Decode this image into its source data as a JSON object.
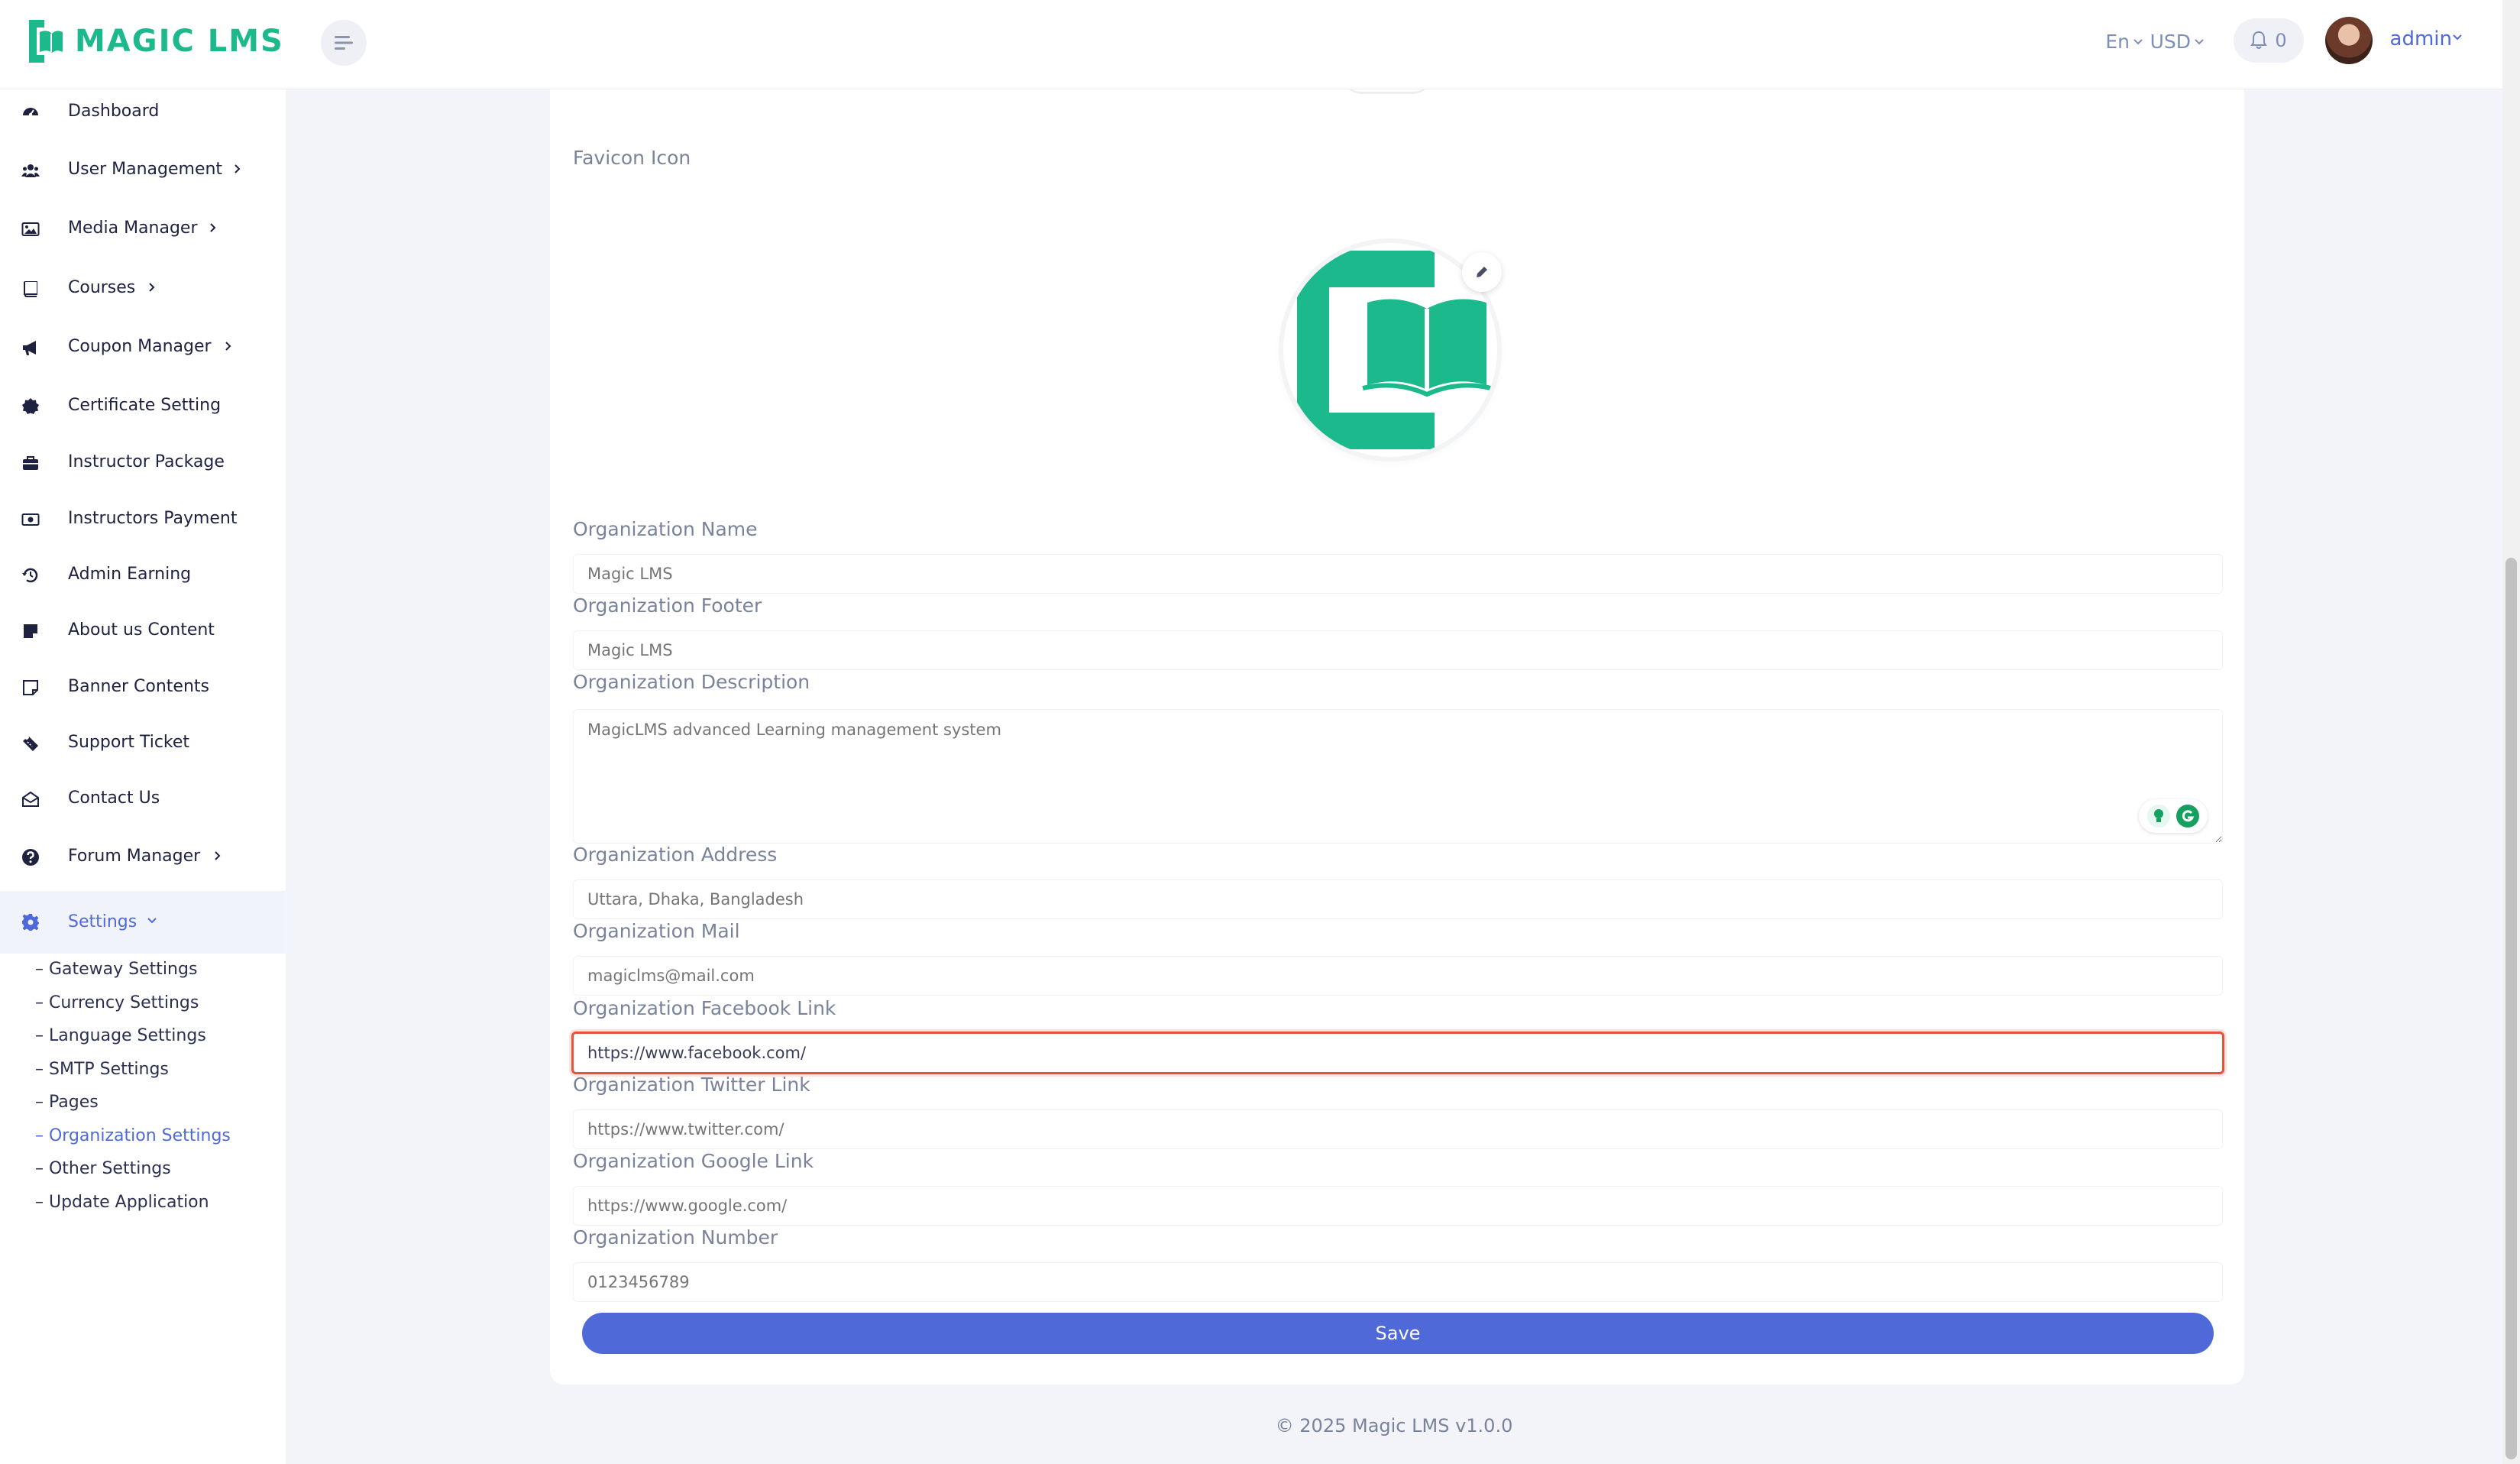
{
  "app": {
    "logo_text": "MAGIC LMS",
    "accent": "#4f6ad8",
    "brand": "#1cb98d"
  },
  "topbar": {
    "language": "En",
    "currency": "USD",
    "notification_count": "0",
    "user_name": "admin"
  },
  "sidebar": {
    "items": [
      {
        "label": "Dashboard",
        "icon": "dashboard-icon"
      },
      {
        "label": "User Management",
        "icon": "users-icon"
      },
      {
        "label": "Media Manager",
        "icon": "image-icon"
      },
      {
        "label": "Courses",
        "icon": "book-icon"
      },
      {
        "label": "Coupon Manager",
        "icon": "megaphone-icon"
      },
      {
        "label": "Certificate Setting",
        "icon": "certificate-icon"
      },
      {
        "label": "Instructor Package",
        "icon": "briefcase-icon"
      },
      {
        "label": "Instructors Payment",
        "icon": "money-icon"
      },
      {
        "label": "Admin Earning",
        "icon": "history-icon"
      },
      {
        "label": "About us Content",
        "icon": "note-icon"
      },
      {
        "label": "Banner Contents",
        "icon": "sticky-note-icon"
      },
      {
        "label": "Support Ticket",
        "icon": "ticket-icon"
      },
      {
        "label": "Contact Us",
        "icon": "envelope-open-icon"
      },
      {
        "label": "Forum Manager",
        "icon": "question-icon"
      },
      {
        "label": "Settings",
        "icon": "gear-icon"
      }
    ],
    "settings_sub": [
      "– Gateway Settings",
      "– Currency Settings",
      "– Language Settings",
      "– SMTP Settings",
      "– Pages",
      "– Organization Settings",
      "– Other Settings",
      "– Update Application"
    ]
  },
  "form": {
    "favicon_label": "Favicon Icon",
    "org_name": {
      "label": "Organization Name",
      "placeholder": "Magic LMS"
    },
    "org_footer": {
      "label": "Organization Footer",
      "placeholder": "Magic LMS"
    },
    "org_description": {
      "label": "Organization Description",
      "placeholder": "MagicLMS advanced Learning management system"
    },
    "org_address": {
      "label": "Organization Address",
      "placeholder": "Uttara, Dhaka, Bangladesh"
    },
    "org_mail": {
      "label": "Organization Mail",
      "placeholder": "magiclms@mail.com"
    },
    "org_facebook": {
      "label": "Organization Facebook Link",
      "value": "https://www.facebook.com/"
    },
    "org_twitter": {
      "label": "Organization Twitter Link",
      "placeholder": "https://www.twitter.com/"
    },
    "org_google": {
      "label": "Organization Google Link",
      "placeholder": "https://www.google.com/"
    },
    "org_number": {
      "label": "Organization Number",
      "placeholder": "0123456789"
    },
    "save_label": "Save"
  },
  "footer": {
    "text": "© 2025 Magic LMS v1.0.0"
  }
}
